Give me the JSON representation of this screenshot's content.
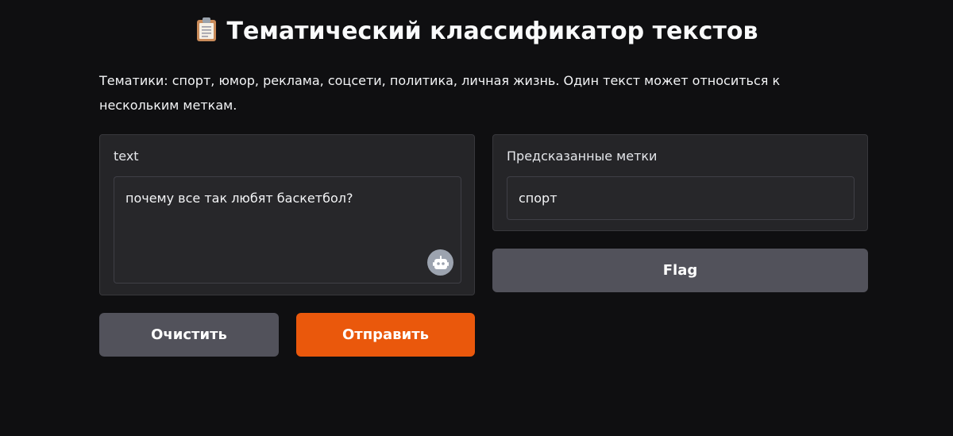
{
  "header": {
    "title": "Тематический классификатор текстов",
    "icon": "clipboard-icon"
  },
  "description": "Тематики: спорт, юмор, реклама, соцсети, политика, личная жизнь. Один текст может относиться к нескольким меткам.",
  "input": {
    "label": "text",
    "value": "почему все так любят баскетбол?",
    "assist_icon": "robot-icon"
  },
  "output": {
    "label": "Предсказанные метки",
    "value": "спорт"
  },
  "buttons": {
    "flag": "Flag",
    "clear": "Очистить",
    "submit": "Отправить"
  },
  "colors": {
    "background": "#0f0f11",
    "panel": "#252528",
    "secondary_button": "#52525b",
    "primary_button": "#ea580c"
  }
}
